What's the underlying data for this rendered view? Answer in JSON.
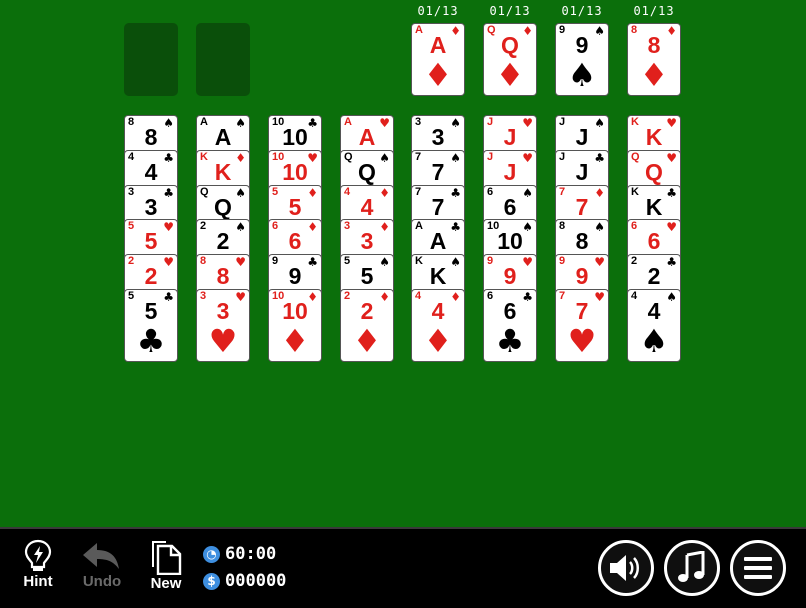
{
  "free_cells": [
    {},
    {}
  ],
  "foundations": [
    {
      "count": "01/13",
      "rank": "A",
      "suit": "♦",
      "color": "red"
    },
    {
      "count": "01/13",
      "rank": "Q",
      "suit": "♦",
      "color": "red"
    },
    {
      "count": "01/13",
      "rank": "9",
      "suit": "♠",
      "color": "black"
    },
    {
      "count": "01/13",
      "rank": "8",
      "suit": "♦",
      "color": "red"
    }
  ],
  "tableau": [
    [
      {
        "rank": "8",
        "suit": "♠",
        "color": "black"
      },
      {
        "rank": "4",
        "suit": "♣",
        "color": "black"
      },
      {
        "rank": "3",
        "suit": "♣",
        "color": "black"
      },
      {
        "rank": "5",
        "suit": "♥",
        "color": "red"
      },
      {
        "rank": "2",
        "suit": "♥",
        "color": "red"
      },
      {
        "rank": "5",
        "suit": "♣",
        "color": "black"
      }
    ],
    [
      {
        "rank": "A",
        "suit": "♠",
        "color": "black"
      },
      {
        "rank": "K",
        "suit": "♦",
        "color": "red"
      },
      {
        "rank": "Q",
        "suit": "♠",
        "color": "black"
      },
      {
        "rank": "2",
        "suit": "♠",
        "color": "black"
      },
      {
        "rank": "8",
        "suit": "♥",
        "color": "red"
      },
      {
        "rank": "3",
        "suit": "♥",
        "color": "red"
      }
    ],
    [
      {
        "rank": "10",
        "suit": "♣",
        "color": "black"
      },
      {
        "rank": "10",
        "suit": "♥",
        "color": "red"
      },
      {
        "rank": "5",
        "suit": "♦",
        "color": "red"
      },
      {
        "rank": "6",
        "suit": "♦",
        "color": "red"
      },
      {
        "rank": "9",
        "suit": "♣",
        "color": "black"
      },
      {
        "rank": "10",
        "suit": "♦",
        "color": "red"
      }
    ],
    [
      {
        "rank": "A",
        "suit": "♥",
        "color": "red"
      },
      {
        "rank": "Q",
        "suit": "♠",
        "color": "black"
      },
      {
        "rank": "4",
        "suit": "♦",
        "color": "red"
      },
      {
        "rank": "3",
        "suit": "♦",
        "color": "red"
      },
      {
        "rank": "5",
        "suit": "♠",
        "color": "black"
      },
      {
        "rank": "2",
        "suit": "♦",
        "color": "red"
      }
    ],
    [
      {
        "rank": "3",
        "suit": "♠",
        "color": "black"
      },
      {
        "rank": "7",
        "suit": "♠",
        "color": "black"
      },
      {
        "rank": "7",
        "suit": "♣",
        "color": "black"
      },
      {
        "rank": "A",
        "suit": "♣",
        "color": "black"
      },
      {
        "rank": "K",
        "suit": "♠",
        "color": "black"
      },
      {
        "rank": "4",
        "suit": "♦",
        "color": "red"
      }
    ],
    [
      {
        "rank": "J",
        "suit": "♥",
        "color": "red"
      },
      {
        "rank": "J",
        "suit": "♥",
        "color": "red"
      },
      {
        "rank": "6",
        "suit": "♠",
        "color": "black"
      },
      {
        "rank": "10",
        "suit": "♠",
        "color": "black"
      },
      {
        "rank": "9",
        "suit": "♥",
        "color": "red"
      },
      {
        "rank": "6",
        "suit": "♣",
        "color": "black"
      }
    ],
    [
      {
        "rank": "J",
        "suit": "♠",
        "color": "black"
      },
      {
        "rank": "J",
        "suit": "♣",
        "color": "black"
      },
      {
        "rank": "7",
        "suit": "♦",
        "color": "red"
      },
      {
        "rank": "8",
        "suit": "♠",
        "color": "black"
      },
      {
        "rank": "9",
        "suit": "♥",
        "color": "red"
      },
      {
        "rank": "7",
        "suit": "♥",
        "color": "red"
      }
    ],
    [
      {
        "rank": "K",
        "suit": "♥",
        "color": "red"
      },
      {
        "rank": "Q",
        "suit": "♥",
        "color": "red"
      },
      {
        "rank": "K",
        "suit": "♣",
        "color": "black"
      },
      {
        "rank": "6",
        "suit": "♥",
        "color": "red"
      },
      {
        "rank": "2",
        "suit": "♣",
        "color": "black"
      },
      {
        "rank": "4",
        "suit": "♠",
        "color": "black"
      }
    ]
  ],
  "toolbar": {
    "hint_label": "Hint",
    "undo_label": "Undo",
    "new_label": "New",
    "timer": "60:00",
    "score": "000000"
  },
  "colors": {
    "felt": "#0b6f0b",
    "red_suit": "#e0201c",
    "black_suit": "#000000"
  },
  "icons": {
    "hint": "lightbulb-icon",
    "undo": "undo-arrow-icon",
    "new": "new-document-icon",
    "timer": "clock-icon",
    "score": "dollar-icon",
    "sound": "speaker-icon",
    "music": "music-note-icon",
    "menu": "hamburger-menu-icon"
  }
}
